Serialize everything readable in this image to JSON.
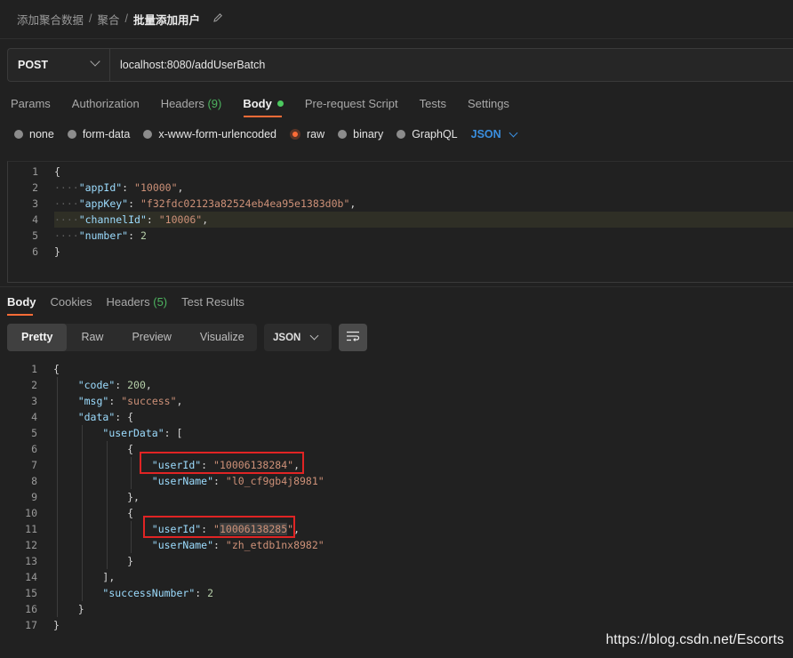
{
  "breadcrumb": {
    "items": [
      "添加聚合数据",
      "聚合"
    ],
    "separator": "/",
    "current": "批量添加用户"
  },
  "request": {
    "method": "POST",
    "url": "localhost:8080/addUserBatch"
  },
  "request_tabs": [
    {
      "label": "Params"
    },
    {
      "label": "Authorization"
    },
    {
      "label": "Headers",
      "count": "(9)"
    },
    {
      "label": "Body",
      "active": true
    },
    {
      "label": "Pre-request Script"
    },
    {
      "label": "Tests"
    },
    {
      "label": "Settings"
    }
  ],
  "body_types": [
    "none",
    "form-data",
    "x-www-form-urlencoded",
    "raw",
    "binary",
    "GraphQL"
  ],
  "body_type_selected": "raw",
  "body_language": "JSON",
  "request_body_lines": [
    "{",
    "    \"appId\": \"10000\",",
    "    \"appKey\": \"f32fdc02123a82524eb4ea95e1383d0b\",",
    "    \"channelId\": \"10006\",",
    "    \"number\": 2",
    "}"
  ],
  "request_body_highlight_line": 4,
  "response_tabs": [
    {
      "label": "Body",
      "active": true
    },
    {
      "label": "Cookies"
    },
    {
      "label": "Headers",
      "count": "(5)"
    },
    {
      "label": "Test Results"
    }
  ],
  "view_modes": [
    "Pretty",
    "Raw",
    "Preview",
    "Visualize"
  ],
  "view_mode_selected": "Pretty",
  "response_format": "JSON",
  "response_lines": [
    "{",
    "    \"code\": 200,",
    "    \"msg\": \"success\",",
    "    \"data\": {",
    "        \"userData\": [",
    "            {",
    "                \"userId\": \"10006138284\",",
    "                \"userName\": \"l0_cf9gb4j8981\"",
    "            },",
    "            {",
    "                \"userId\": \"10006138285\",",
    "                \"userName\": \"zh_etdb1nx8982\"",
    "            }",
    "        ],",
    "        \"successNumber\": 2",
    "    }",
    "}"
  ],
  "response_boxed_lines": [
    7,
    11
  ],
  "watermark": "https://blog.csdn.net/Escorts",
  "colors": {
    "accent": "#ff6c37",
    "success_dot": "#4cc95f",
    "link": "#3a8fe0",
    "annotation_box": "#e02424"
  },
  "icons": {
    "edit": "pencil-icon",
    "method_dropdown": "chevron-down-icon",
    "wrap": "wrap-lines-icon"
  }
}
